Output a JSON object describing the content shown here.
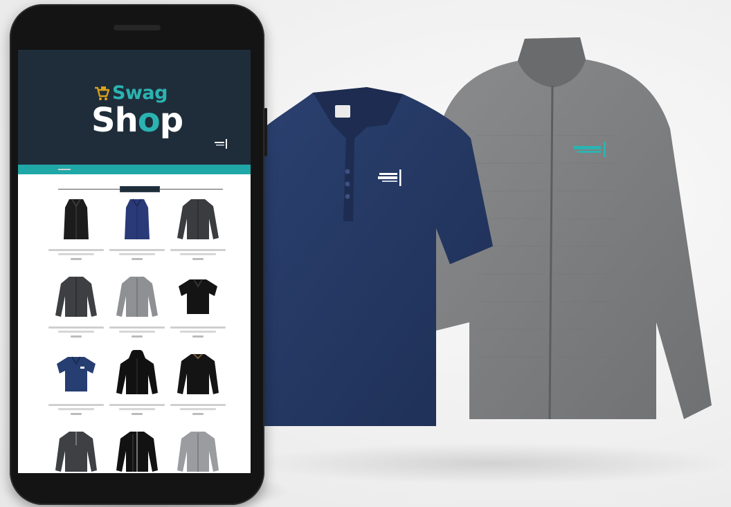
{
  "brand": {
    "word1": "Swag",
    "word2_part1": "Sh",
    "word2_o": "o",
    "word2_part2": "p"
  },
  "colors": {
    "hero_bg": "#1f2d3a",
    "accent_teal": "#2bb3b1",
    "teal_bar": "#20a7a7",
    "polo_navy": "#22355e",
    "jacket_gray": "#7f8082",
    "phone_body": "#141414"
  },
  "products": [
    {
      "icon": "vest-black-icon"
    },
    {
      "icon": "vest-navy-icon"
    },
    {
      "icon": "jacket-charcoal-icon"
    },
    {
      "icon": "jacket-charcoal-icon"
    },
    {
      "icon": "jacket-gray-icon"
    },
    {
      "icon": "polo-black-icon"
    },
    {
      "icon": "polo-navy-icon"
    },
    {
      "icon": "hoodie-black-icon"
    },
    {
      "icon": "pullover-black-icon"
    },
    {
      "icon": "quarter-zip-charcoal-icon"
    },
    {
      "icon": "track-jacket-black-icon"
    },
    {
      "icon": "cardigan-gray-icon"
    }
  ]
}
